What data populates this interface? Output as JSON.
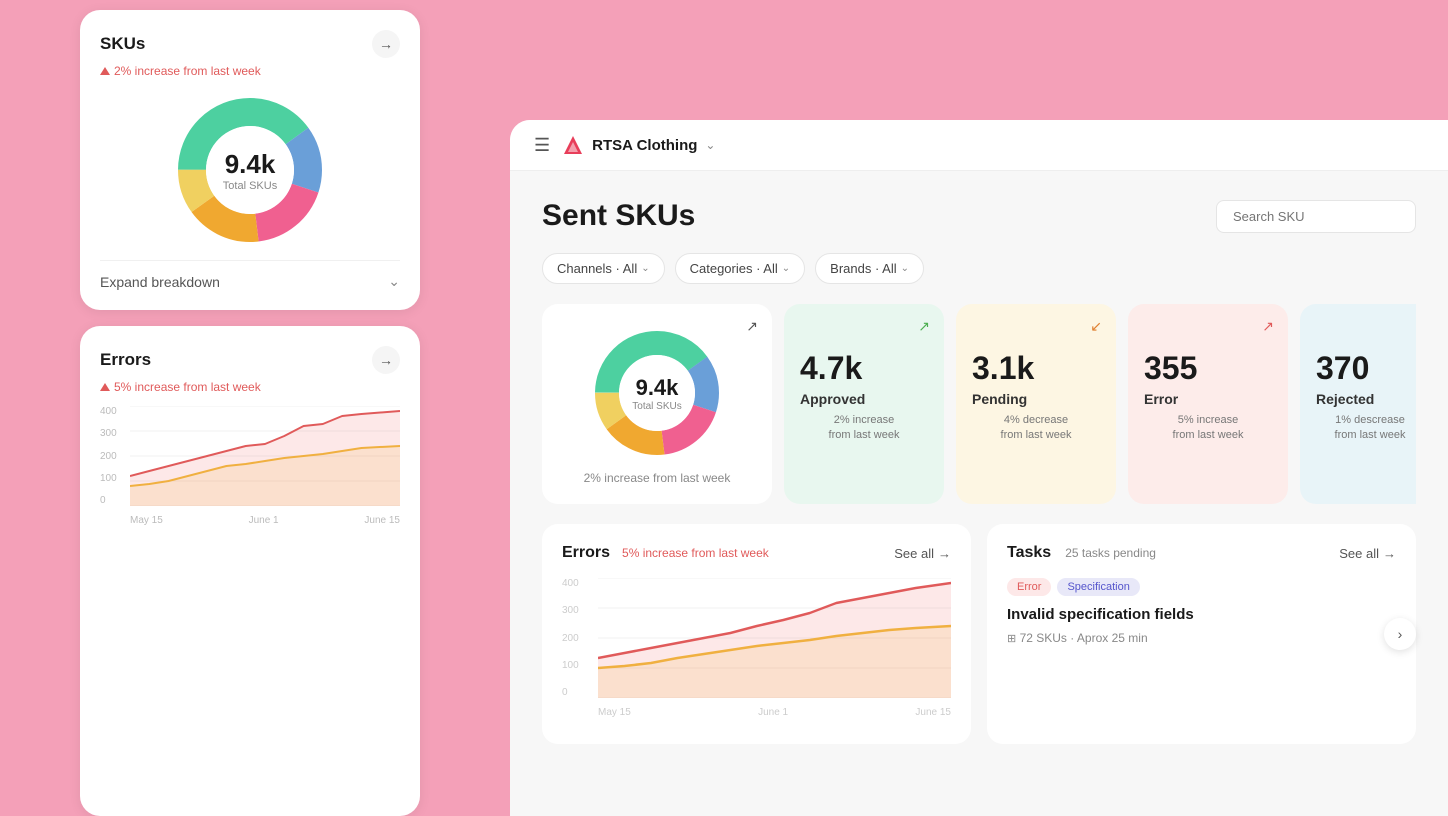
{
  "background_color": "#f4a0b8",
  "left_panel": {
    "sku_card": {
      "title": "SKUs",
      "increase_text": "2% increase from last week",
      "donut": {
        "value": "9.4k",
        "label": "Total SKUs",
        "segments": [
          {
            "color": "#4dd0a0",
            "pct": 40
          },
          {
            "color": "#6a9fd8",
            "pct": 15
          },
          {
            "color": "#f06090",
            "pct": 18
          },
          {
            "color": "#f0a830",
            "pct": 17
          },
          {
            "color": "#f0d060",
            "pct": 10
          }
        ]
      },
      "expand_text": "Expand breakdown"
    },
    "errors_card": {
      "title": "Errors",
      "increase_text": "5% increase from last week",
      "chart": {
        "y_labels": [
          "400",
          "300",
          "200",
          "100",
          "0"
        ],
        "x_labels": [
          "May 15",
          "June 1",
          "June 15"
        ]
      }
    }
  },
  "main": {
    "topbar": {
      "menu_icon": "☰",
      "brand_name": "RTSA Clothing",
      "brand_chevron": "⌄"
    },
    "page_title": "Sent SKUs",
    "search_placeholder": "Search SKU",
    "filters": [
      {
        "label": "Channels · All"
      },
      {
        "label": "Categories · All"
      },
      {
        "label": "Brands · All"
      }
    ],
    "stats": [
      {
        "type": "main",
        "value": "9.4k",
        "label": "Total SKUs",
        "sub": "2% increase from last week"
      },
      {
        "type": "green",
        "value": "4.7k",
        "label": "Approved",
        "sub": "2% increase\nfrom last week"
      },
      {
        "type": "yellow",
        "value": "3.1k",
        "label": "Pending",
        "sub": "4% decrease\nfrom last week"
      },
      {
        "type": "red",
        "value": "355",
        "label": "Error",
        "sub": "5% increase\nfrom last week"
      },
      {
        "type": "blue",
        "value": "370",
        "label": "Rejected",
        "sub": "1% descrease\nfrom last week"
      }
    ],
    "errors_section": {
      "title": "Errors",
      "badge_text": "5% increase from last week",
      "see_all": "See all",
      "chart": {
        "y_labels": [
          "400",
          "300",
          "200",
          "100",
          "0"
        ],
        "x_labels": [
          "May 15",
          "June 1",
          "June 15"
        ]
      }
    },
    "tasks_section": {
      "title": "Tasks",
      "badge_text": "25 tasks pending",
      "see_all": "See all",
      "task": {
        "tags": [
          "Error",
          "Specification"
        ],
        "title": "Invalid specification fields",
        "meta": "72 SKUs · Aprox 25 min"
      }
    }
  }
}
